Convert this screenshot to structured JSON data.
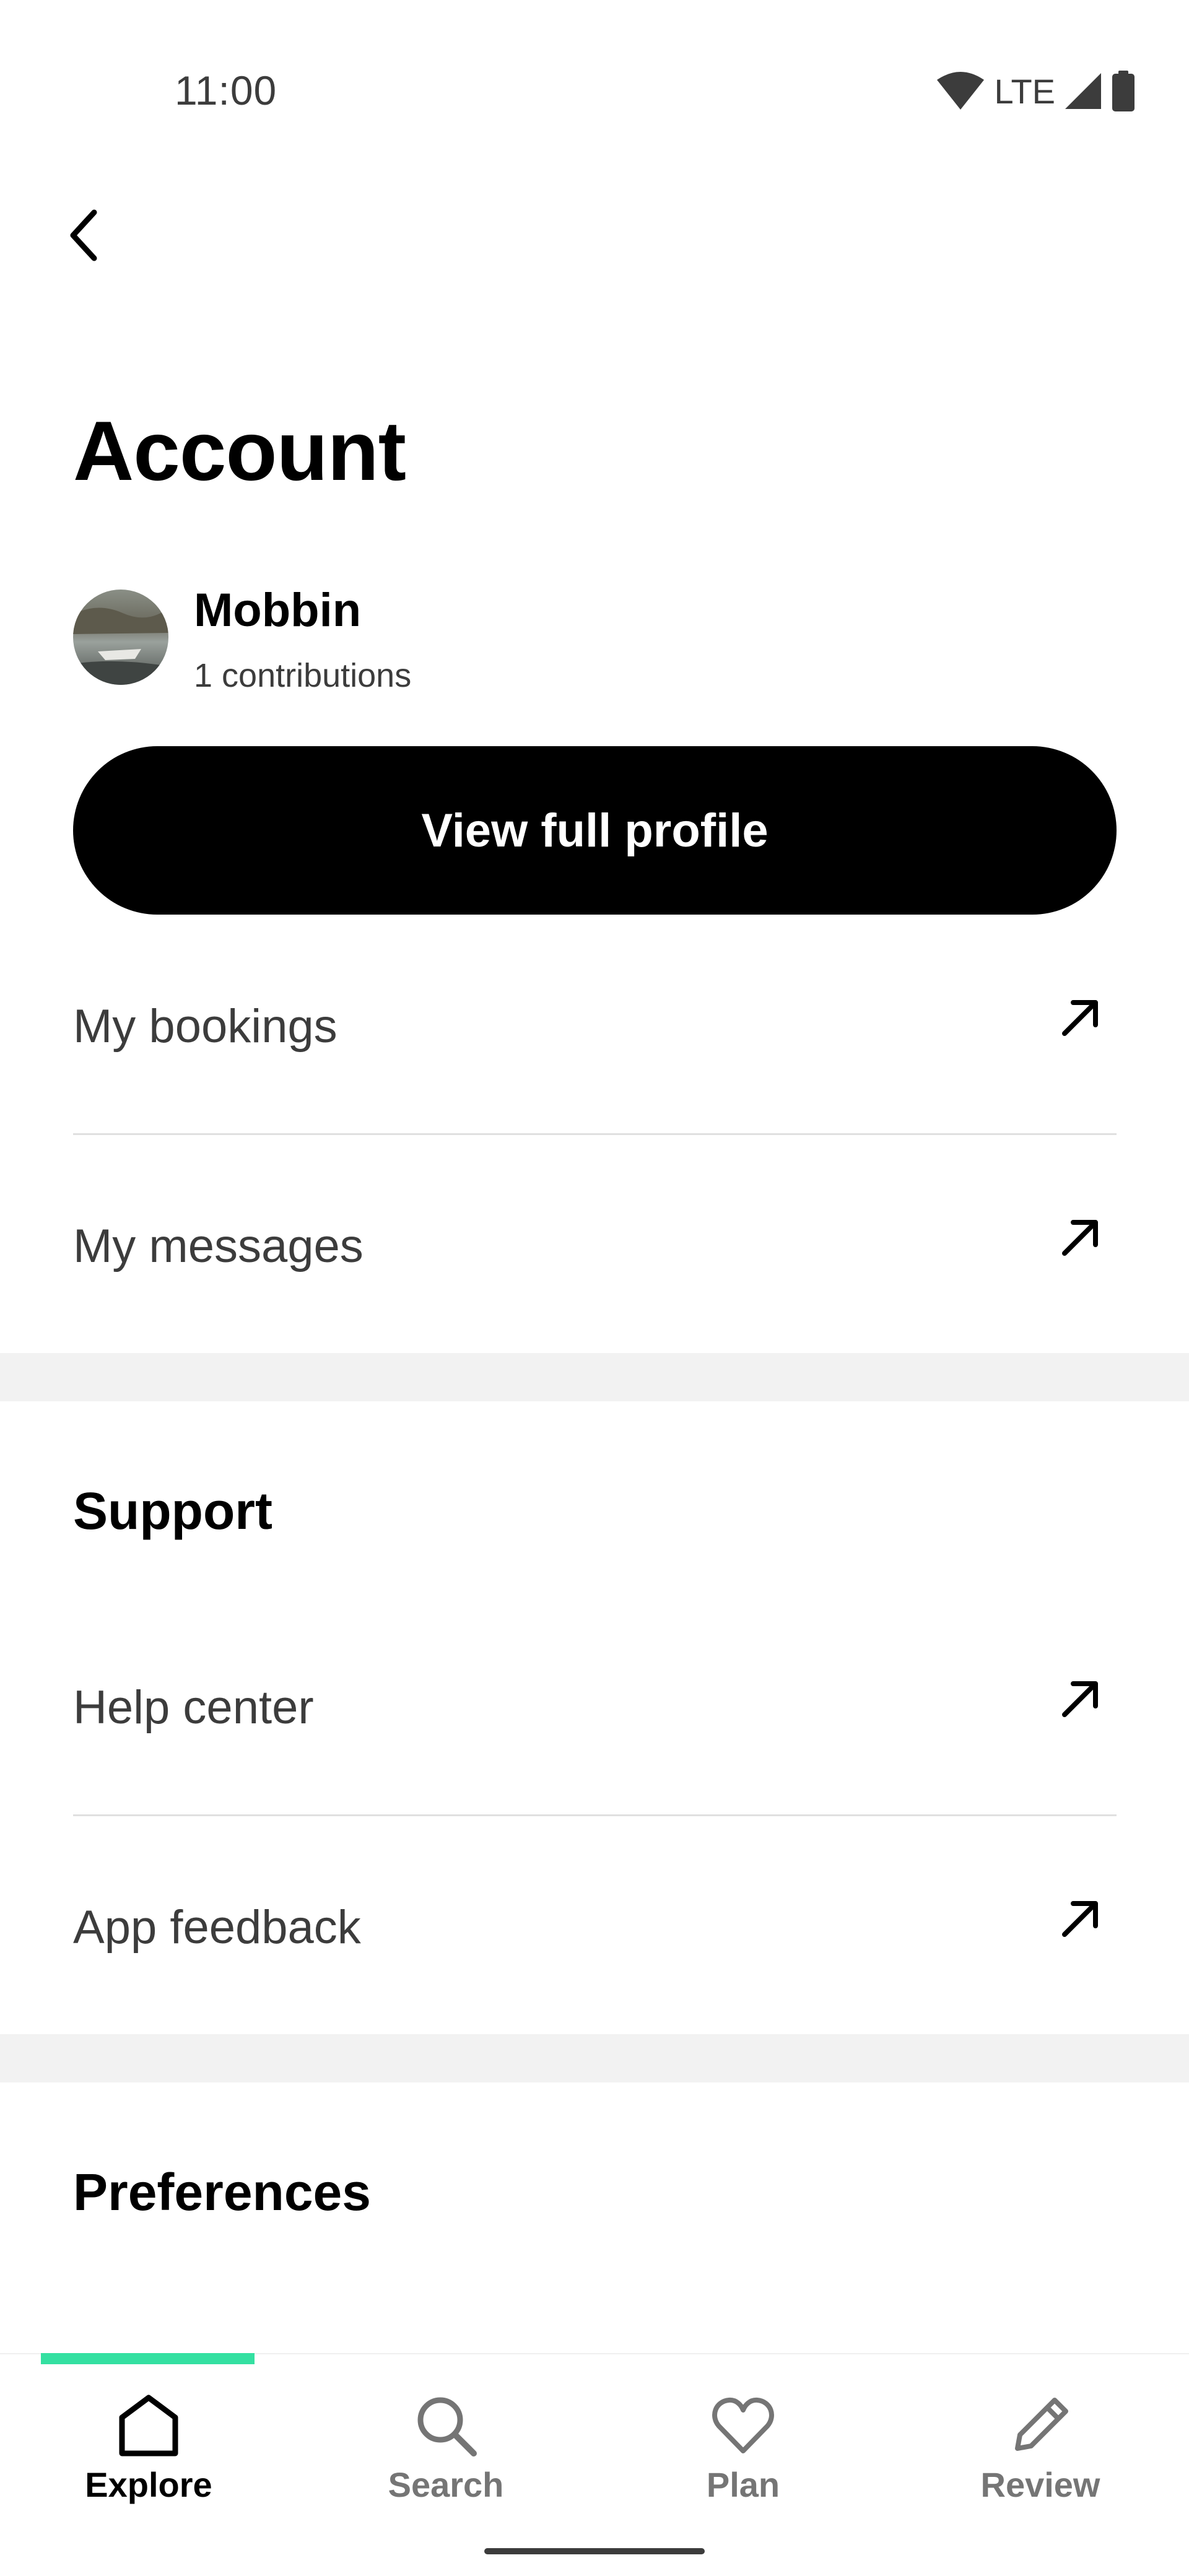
{
  "status_bar": {
    "time": "11:00",
    "network": "LTE"
  },
  "header": {
    "back_icon": "chevron-left-icon",
    "title": "Account"
  },
  "profile": {
    "name": "Mobbin",
    "contributions": "1 contributions",
    "button_label": "View full profile"
  },
  "account_links": [
    {
      "label": "My bookings",
      "icon": "arrow-up-right-icon"
    },
    {
      "label": "My messages",
      "icon": "arrow-up-right-icon"
    }
  ],
  "support": {
    "heading": "Support",
    "items": [
      {
        "label": "Help center",
        "icon": "arrow-up-right-icon"
      },
      {
        "label": "App feedback",
        "icon": "arrow-up-right-icon"
      }
    ]
  },
  "preferences": {
    "heading": "Preferences"
  },
  "bottom_nav": {
    "active": "Explore",
    "accent_color": "#34e0a1",
    "items": [
      {
        "label": "Explore",
        "icon": "home-icon"
      },
      {
        "label": "Search",
        "icon": "search-icon"
      },
      {
        "label": "Plan",
        "icon": "heart-icon"
      },
      {
        "label": "Review",
        "icon": "pencil-icon"
      }
    ]
  }
}
